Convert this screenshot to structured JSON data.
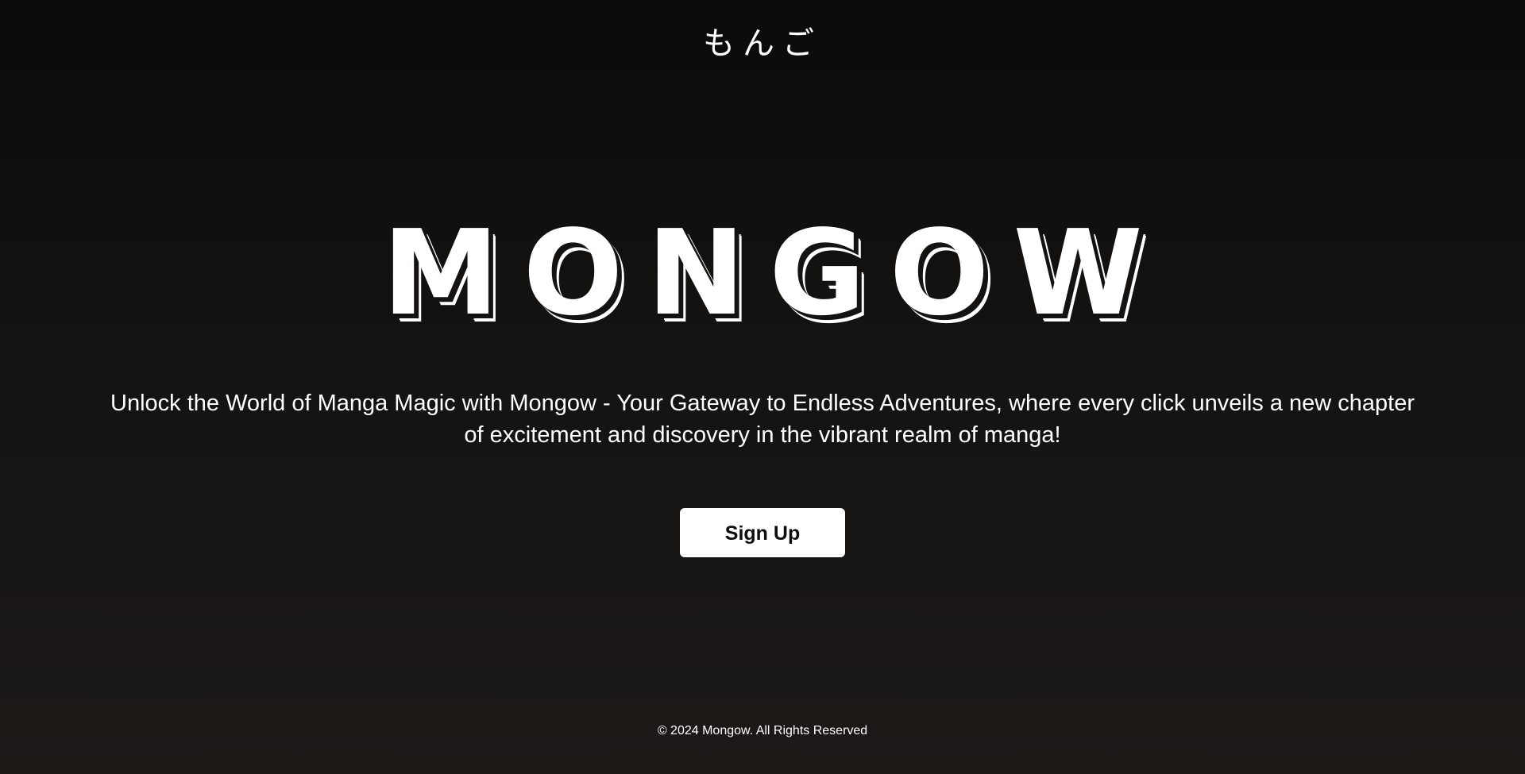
{
  "header": {
    "brand_jp": "もんご"
  },
  "hero": {
    "title": "MONGOW",
    "tagline": "Unlock the World of Manga Magic with Mongow - Your Gateway to Endless Adventures, where every click unveils a new chapter of excitement and discovery in the vibrant realm of manga!"
  },
  "cta": {
    "signup_label": "Sign Up"
  },
  "footer": {
    "copyright": "© 2024 Mongow. All Rights Reserved"
  },
  "colors": {
    "background_top": "#0b0b0b",
    "background_bottom": "#1c1917",
    "text": "#ffffff",
    "button_bg": "#ffffff",
    "button_text": "#0e0d0c"
  }
}
